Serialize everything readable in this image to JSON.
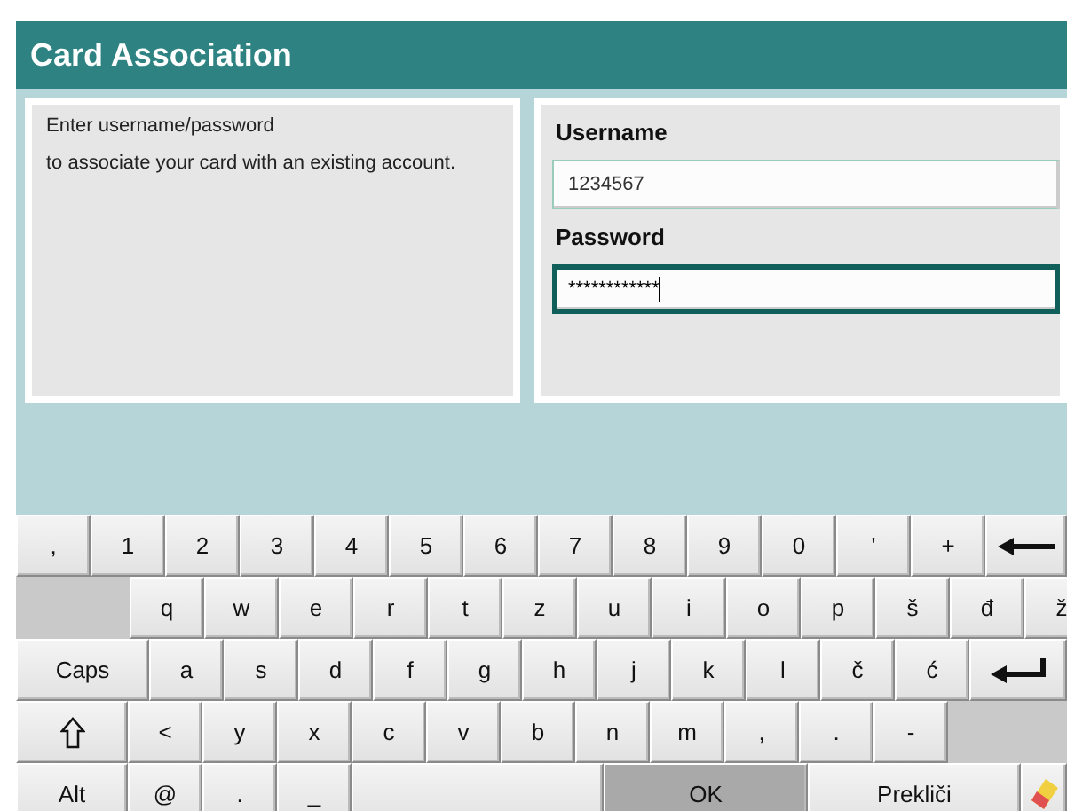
{
  "window": {
    "title": "Card Association"
  },
  "info": {
    "lines": [
      "Enter username/password",
      "to associate your card with an existing account."
    ]
  },
  "form": {
    "fields": [
      {
        "label": "Username",
        "value": "1234567",
        "focused": false
      },
      {
        "label": "Password",
        "value": "************",
        "focused": true
      }
    ]
  },
  "keyboard": {
    "rows": [
      {
        "keys": [
          {
            "kind": "char",
            "label": ","
          },
          {
            "kind": "char",
            "label": "1"
          },
          {
            "kind": "char",
            "label": "2"
          },
          {
            "kind": "char",
            "label": "3"
          },
          {
            "kind": "char",
            "label": "4"
          },
          {
            "kind": "char",
            "label": "5"
          },
          {
            "kind": "char",
            "label": "6"
          },
          {
            "kind": "char",
            "label": "7"
          },
          {
            "kind": "char",
            "label": "8"
          },
          {
            "kind": "char",
            "label": "9"
          },
          {
            "kind": "char",
            "label": "0"
          },
          {
            "kind": "char",
            "label": "'"
          },
          {
            "kind": "char",
            "label": "+"
          },
          {
            "kind": "backspace"
          }
        ]
      },
      {
        "keys": [
          {
            "kind": "blank"
          },
          {
            "kind": "char",
            "label": "q"
          },
          {
            "kind": "char",
            "label": "w"
          },
          {
            "kind": "char",
            "label": "e"
          },
          {
            "kind": "char",
            "label": "r"
          },
          {
            "kind": "char",
            "label": "t"
          },
          {
            "kind": "char",
            "label": "z"
          },
          {
            "kind": "char",
            "label": "u"
          },
          {
            "kind": "char",
            "label": "i"
          },
          {
            "kind": "char",
            "label": "o"
          },
          {
            "kind": "char",
            "label": "p"
          },
          {
            "kind": "char",
            "label": "š"
          },
          {
            "kind": "char",
            "label": "đ"
          },
          {
            "kind": "char",
            "label": "ž"
          }
        ]
      },
      {
        "keys": [
          {
            "kind": "wide",
            "label": "Caps"
          },
          {
            "kind": "char",
            "label": "a"
          },
          {
            "kind": "char",
            "label": "s"
          },
          {
            "kind": "char",
            "label": "d"
          },
          {
            "kind": "char",
            "label": "f"
          },
          {
            "kind": "char",
            "label": "g"
          },
          {
            "kind": "char",
            "label": "h"
          },
          {
            "kind": "char",
            "label": "j"
          },
          {
            "kind": "char",
            "label": "k"
          },
          {
            "kind": "char",
            "label": "l"
          },
          {
            "kind": "char",
            "label": "č"
          },
          {
            "kind": "char",
            "label": "ć"
          },
          {
            "kind": "enter"
          }
        ]
      },
      {
        "keys": [
          {
            "kind": "shift"
          },
          {
            "kind": "char",
            "label": "<"
          },
          {
            "kind": "char",
            "label": "y"
          },
          {
            "kind": "char",
            "label": "x"
          },
          {
            "kind": "char",
            "label": "c"
          },
          {
            "kind": "char",
            "label": "v"
          },
          {
            "kind": "char",
            "label": "b"
          },
          {
            "kind": "char",
            "label": "n"
          },
          {
            "kind": "char",
            "label": "m"
          },
          {
            "kind": "char",
            "label": ","
          },
          {
            "kind": "char",
            "label": "."
          },
          {
            "kind": "char",
            "label": "-"
          },
          {
            "kind": "blank"
          }
        ]
      },
      {
        "keys": [
          {
            "kind": "mod",
            "label": "Alt"
          },
          {
            "kind": "char",
            "label": "@"
          },
          {
            "kind": "char",
            "label": "."
          },
          {
            "kind": "char",
            "label": "_"
          },
          {
            "kind": "space"
          },
          {
            "kind": "action",
            "label": "OK",
            "emphasis": true
          },
          {
            "kind": "action",
            "label": "Prekliči",
            "emphasis": false
          },
          {
            "kind": "eraser"
          }
        ]
      }
    ]
  }
}
